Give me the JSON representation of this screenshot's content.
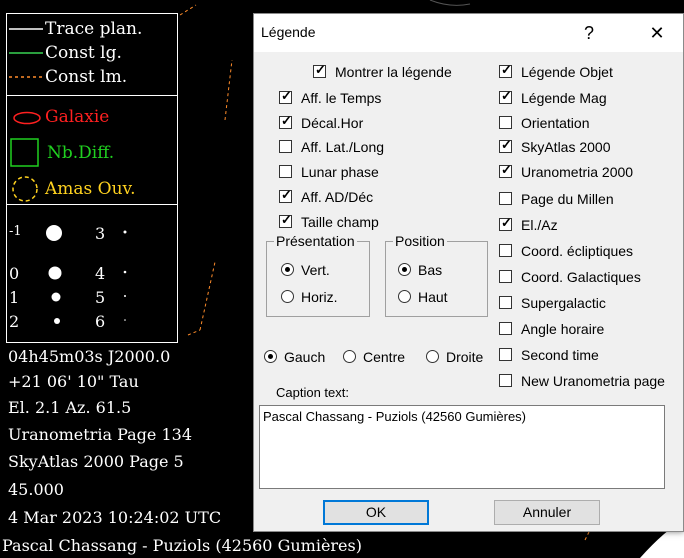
{
  "chart_legend": {
    "lines": [
      {
        "label": "Trace plan.",
        "color": "#ffffff",
        "style": "solid"
      },
      {
        "label": "Const lg.",
        "color": "#39d353",
        "style": "solid"
      },
      {
        "label": "Const lm.",
        "color": "#ff8c2a",
        "style": "dashed"
      }
    ],
    "galaxy_label": "Galaxie",
    "galaxy_color": "#ff2020",
    "nebula_label": "Nb.Diff.",
    "nebula_color": "#20d020",
    "cluster_label": "Amas Ouv.",
    "cluster_color": "#ffd21f",
    "magnitudes": [
      {
        "left": "-1",
        "right": "3"
      },
      {
        "left": "0",
        "right": "4"
      },
      {
        "left": "1",
        "right": "5"
      },
      {
        "left": "2",
        "right": "6"
      }
    ]
  },
  "chart_info": {
    "coords": "04h45m03s   J2000.0",
    "dec": "+21 06' 10\"      Tau",
    "elaz": "El. 2.1  Az. 61.5",
    "urano": "Uranometria Page 134",
    "skyatlas": "SkyAtlas 2000 Page 5",
    "field": "45.000",
    "time": " 4 Mar 2023 10:24:02 UTC",
    "caption": "Pascal Chassang - Puziols (42560 Gumières)"
  },
  "dialog": {
    "title": "Légende",
    "help": "?",
    "close": "✕",
    "show_legend": {
      "label": "Montrer la légende",
      "checked": true
    },
    "left_checks": [
      {
        "label": "Aff. le Temps",
        "checked": true
      },
      {
        "label": "Décal.Hor",
        "checked": true
      },
      {
        "label": "Aff. Lat./Long",
        "checked": false
      },
      {
        "label": "Lunar phase",
        "checked": false
      },
      {
        "label": "Aff. AD/Déc",
        "checked": true
      },
      {
        "label": "Taille champ",
        "checked": true
      }
    ],
    "right_checks": [
      {
        "label": "Légende Objet",
        "checked": true
      },
      {
        "label": "Légende Mag",
        "checked": true
      },
      {
        "label": "Orientation",
        "checked": false
      },
      {
        "label": "SkyAtlas 2000",
        "checked": true
      },
      {
        "label": "Uranometria 2000",
        "checked": true
      },
      {
        "label": "Page du Millen",
        "checked": false
      },
      {
        "label": "El./Az",
        "checked": true
      },
      {
        "label": "Coord. écliptiques",
        "checked": false
      },
      {
        "label": "Coord. Galactiques",
        "checked": false
      },
      {
        "label": "Supergalactic",
        "checked": false
      },
      {
        "label": "Angle horaire",
        "checked": false
      },
      {
        "label": "Second time",
        "checked": false
      },
      {
        "label": "New Uranometria page",
        "checked": false
      }
    ],
    "presentation": {
      "title": "Présentation",
      "options": [
        {
          "label": "Vert.",
          "selected": true
        },
        {
          "label": "Horiz.",
          "selected": false
        }
      ]
    },
    "position": {
      "title": "Position",
      "options": [
        {
          "label": "Bas",
          "selected": true
        },
        {
          "label": "Haut",
          "selected": false
        }
      ]
    },
    "align": [
      {
        "label": "Gauch",
        "selected": true
      },
      {
        "label": "Centre",
        "selected": false
      },
      {
        "label": "Droite",
        "selected": false
      }
    ],
    "caption_label": "Caption text:",
    "caption_value": "Pascal Chassang - Puziols (42560 Gumières)",
    "ok": "OK",
    "cancel": "Annuler"
  }
}
